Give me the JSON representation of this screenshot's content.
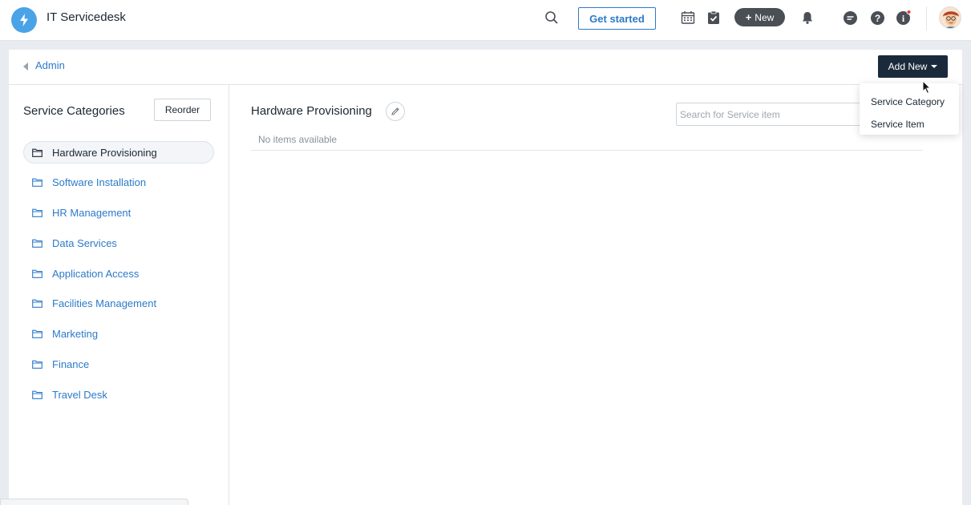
{
  "app": {
    "title": "IT Servicedesk"
  },
  "topbar": {
    "get_started": "Get started",
    "new_label": "New",
    "notification_dot_color": "#e23b3b"
  },
  "breadcrumb": {
    "label": "Admin"
  },
  "header": {
    "add_new": "Add New"
  },
  "dropdown": {
    "items": [
      "Service Category",
      "Service Item"
    ]
  },
  "sidebar": {
    "title": "Service Categories",
    "reorder": "Reorder",
    "items": [
      {
        "label": "Hardware Provisioning",
        "active": true
      },
      {
        "label": "Software Installation"
      },
      {
        "label": "HR Management"
      },
      {
        "label": "Data Services"
      },
      {
        "label": "Application Access"
      },
      {
        "label": "Facilities Management"
      },
      {
        "label": "Marketing"
      },
      {
        "label": "Finance"
      },
      {
        "label": "Travel Desk"
      }
    ]
  },
  "main": {
    "title": "Hardware Provisioning",
    "search_placeholder": "Search for Service item",
    "empty_text": "No items available"
  },
  "colors": {
    "accent": "#2c7ac9",
    "dark": "#1b2a3b",
    "logo": "#4aa3e6"
  }
}
